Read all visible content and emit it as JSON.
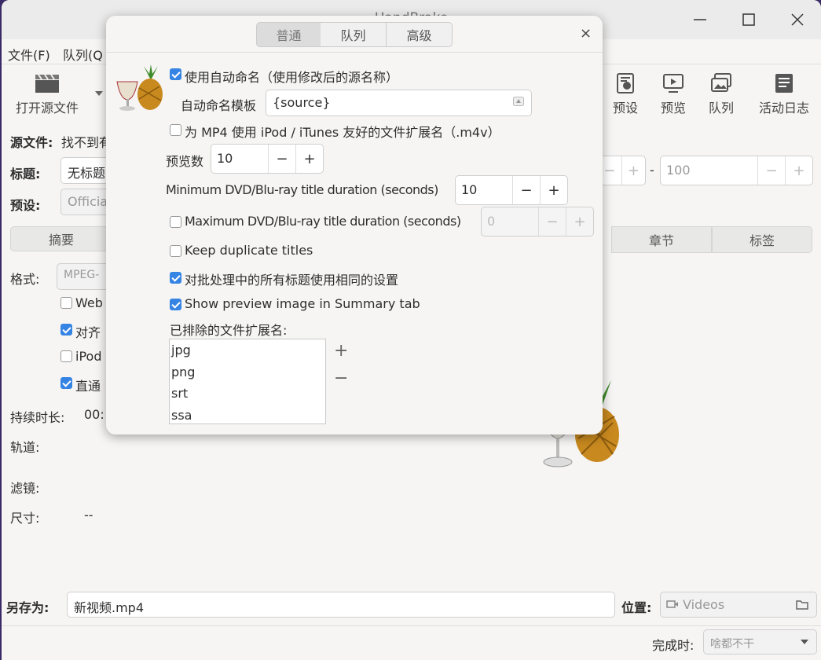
{
  "window": {
    "title": "HandBrake"
  },
  "menu": {
    "file": "文件(F)",
    "queue": "队列(Q"
  },
  "toolbar": {
    "open_source": "打开源文件",
    "presets": "预设",
    "preview": "预览",
    "queue": "队列",
    "activity": "活动日志"
  },
  "source": {
    "label": "源文件:",
    "value": "找不到有"
  },
  "title_row": {
    "label": "标题:",
    "value": "无标题",
    "range_start": "",
    "range_end": "100",
    "dash": "-"
  },
  "preset_row": {
    "label": "预设:",
    "value": "Officia"
  },
  "tabs": {
    "summary": "摘要",
    "chapters": "章节",
    "tags": "标签"
  },
  "summary": {
    "format_label": "格式:",
    "format_value": "MPEG-",
    "web": "Web",
    "align": "对齐",
    "ipod": "iPod",
    "passthru": "直通",
    "duration_label": "持续时长:",
    "duration_value": "00:",
    "tracks_label": "轨道:",
    "filters_label": "滤镜:",
    "size_label": "尺寸:",
    "size_value": "--"
  },
  "save": {
    "label": "另存为:",
    "value": "新视频.mp4",
    "location_label": "位置:",
    "location_value": "Videos"
  },
  "when_done": {
    "label": "完成时:",
    "value": "啥都不干"
  },
  "dialog": {
    "tabs": [
      "普通",
      "队列",
      "高级"
    ],
    "close": "×",
    "auto_name": "使用自动命名（使用修改后的源名称）",
    "template_label": "自动命名模板",
    "template_value": "{source}",
    "m4v": "为 MP4 使用 iPod / iTunes 友好的文件扩展名（.m4v）",
    "preview_count_label": "预览数",
    "preview_count_value": "10",
    "min_dur_label": "Minimum DVD/Blu-ray title duration (seconds)",
    "min_dur_value": "10",
    "max_dur_label": "Maximum DVD/Blu-ray title duration (seconds)",
    "max_dur_value": "0",
    "dup_titles": "Keep duplicate titles",
    "same_settings": "对批处理中的所有标题使用相同的设置",
    "show_preview": "Show preview image in Summary tab",
    "excluded_label": "已排除的文件扩展名:",
    "excluded": [
      "jpg",
      "png",
      "srt",
      "ssa"
    ],
    "add": "+",
    "remove": "−",
    "minus": "−",
    "plus": "+"
  },
  "colors": {
    "accent": "#3584e4",
    "bg": "#f6f5f4"
  }
}
